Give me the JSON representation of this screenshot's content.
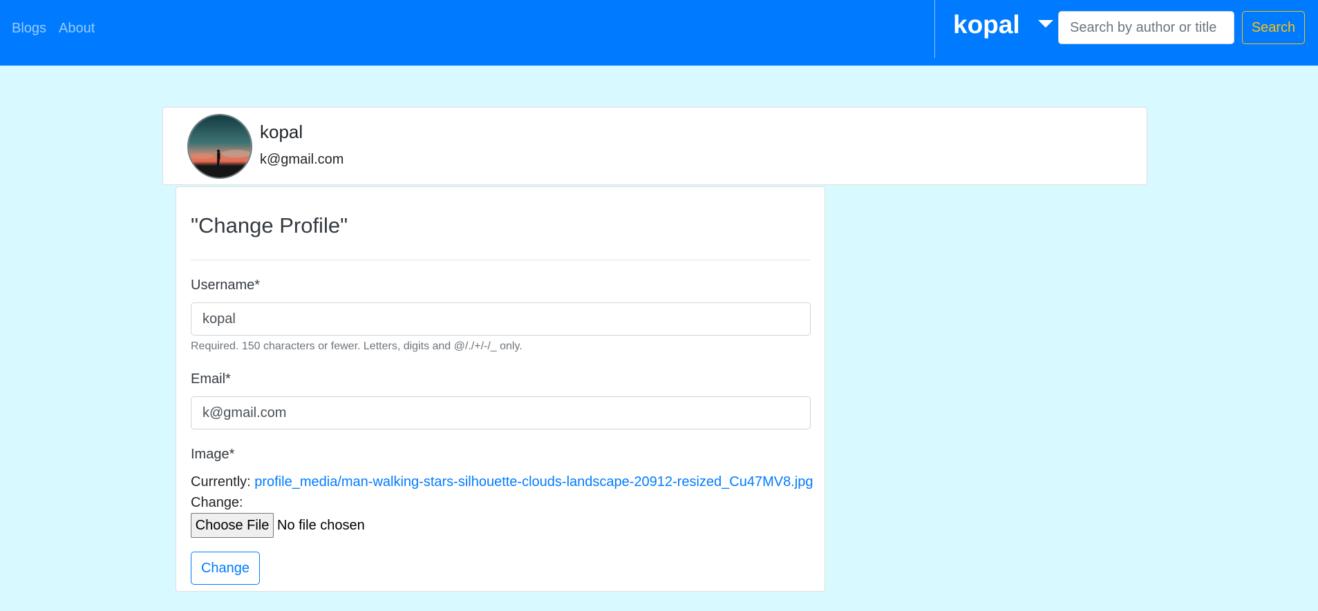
{
  "navbar": {
    "links": [
      {
        "label": "Blogs"
      },
      {
        "label": "About"
      }
    ],
    "user_menu": {
      "label": "kopal",
      "icon": "caret-down-icon"
    },
    "search": {
      "placeholder": "Search by author or title",
      "button_label": "Search"
    },
    "colors": {
      "background": "#007bff",
      "search_button": "#ffc107"
    }
  },
  "profile": {
    "name": "kopal",
    "email": "k@gmail.com",
    "avatar": "avatar-image"
  },
  "form": {
    "legend": "\"Change Profile\"",
    "username": {
      "label": "Username*",
      "value": "kopal",
      "help": "Required. 150 characters or fewer. Letters, digits and @/./+/-/_ only."
    },
    "email": {
      "label": "Email*",
      "value": "k@gmail.com"
    },
    "image": {
      "label": "Image*",
      "currently_label": "Currently:",
      "current_file": "profile_media/man-walking-stars-silhouette-clouds-landscape-20912-resized_Cu47MV8.jpg",
      "change_label": "Change:",
      "choose_button": "Choose File",
      "file_status": "No file chosen"
    },
    "submit_label": "Change"
  },
  "colors": {
    "page_background": "#d8f9ff",
    "accent": "#007bff"
  }
}
